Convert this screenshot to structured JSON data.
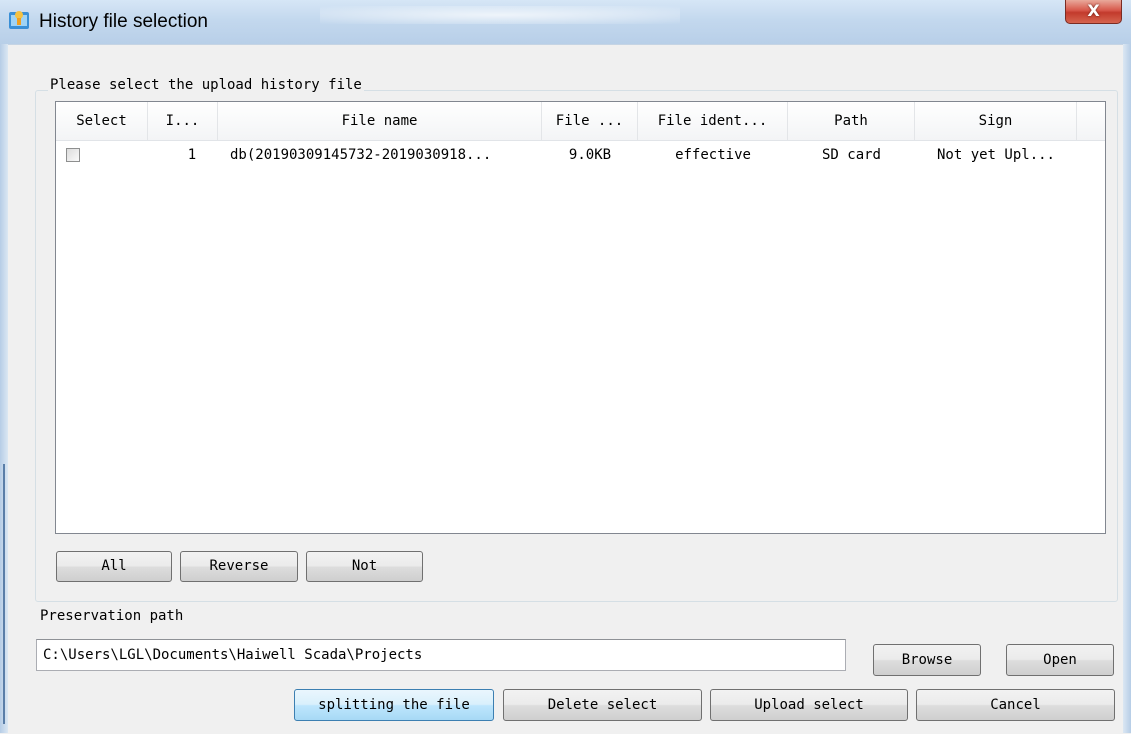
{
  "window": {
    "title": "History file selection",
    "close_label": "X"
  },
  "group": {
    "legend": "Please select the upload history file"
  },
  "table": {
    "columns": [
      "Select",
      "I...",
      "File name",
      "File ...",
      "File ident...",
      "Path",
      "Sign"
    ],
    "rows": [
      {
        "checked": false,
        "index": "1",
        "file_name": "db(20190309145732-2019030918...",
        "file_size": "9.0KB",
        "file_identity": "effective",
        "path": "SD card",
        "sign": "Not yet Upl..."
      }
    ]
  },
  "selection_buttons": {
    "all": "All",
    "reverse": "Reverse",
    "not": "Not"
  },
  "preservation": {
    "label": "Preservation path",
    "value": "C:\\Users\\LGL\\Documents\\Haiwell Scada\\Projects",
    "browse": "Browse",
    "open": "Open"
  },
  "actions": {
    "split": "splitting the file",
    "delete": "Delete select",
    "upload": "Upload select",
    "cancel": "Cancel"
  },
  "colors": {
    "titlebar": "#c3d8ee",
    "close_button": "#d7574a",
    "focus_border": "#3c7fb1"
  }
}
